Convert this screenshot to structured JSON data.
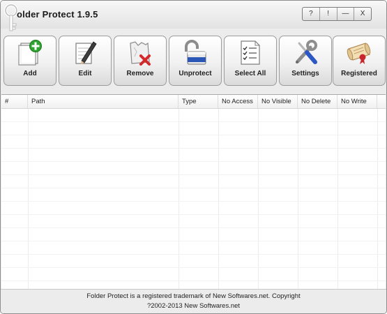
{
  "app": {
    "title": "older Protect 1.9.5"
  },
  "window_controls": [
    "?",
    "!",
    "—",
    "X"
  ],
  "toolbar": {
    "add": "Add",
    "edit": "Edit",
    "remove": "Remove",
    "unprotect": "Unprotect",
    "select_all": "Select All",
    "settings": "Settings",
    "registered": "Registered"
  },
  "table": {
    "columns": [
      "#",
      "Path",
      "Type",
      "No Access",
      "No Visible",
      "No Delete",
      "No Write"
    ],
    "rows": []
  },
  "footer": {
    "line1": "Folder Protect is a registered trademark of New Softwares.net. Copyright",
    "line2": "?2002-2013 New Softwares.net"
  },
  "icons": {
    "add": "add-document-icon",
    "edit": "pencil-notepad-icon",
    "remove": "remove-folder-icon",
    "unprotect": "padlock-open-icon",
    "select_all": "checklist-icon",
    "settings": "wrench-screwdriver-icon",
    "registered": "certificate-icon"
  },
  "colors": {
    "accent_green": "#2fa32f",
    "remove_red": "#d4282b",
    "padlock_blue": "#2a56b8"
  }
}
